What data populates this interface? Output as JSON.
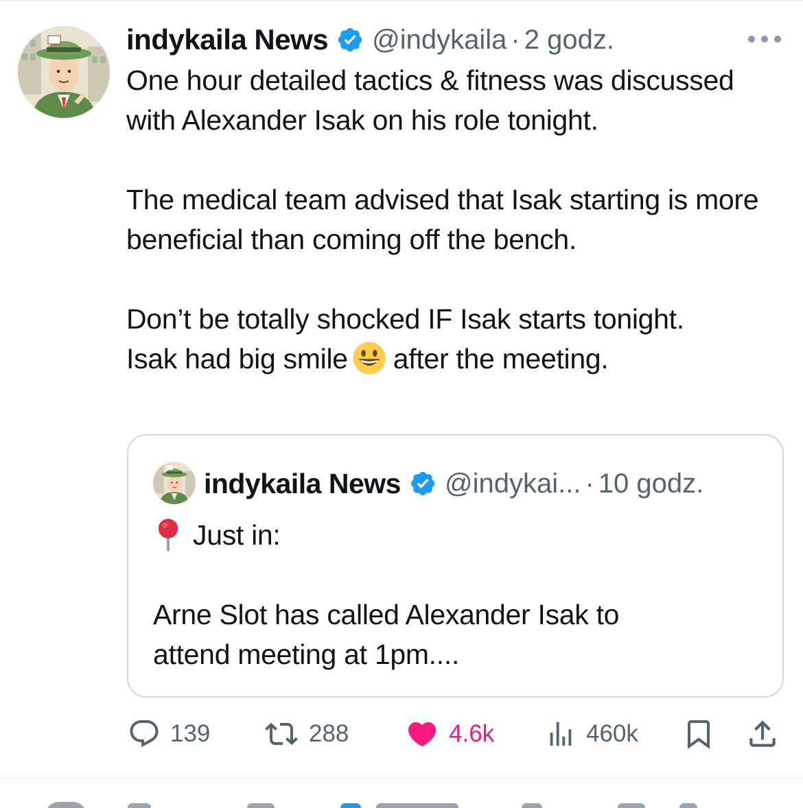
{
  "tweet": {
    "author_name": "indykaila News",
    "handle": "@indykaila",
    "separator": "·",
    "time": "2 godz.",
    "body": [
      "One hour detailed tactics & fitness was discussed with Alexander Isak on his role tonight.",
      "The medical team advised that Isak starting is more beneficial than coming off the bench."
    ],
    "body_last_line1": "Don’t be totally shocked IF Isak starts tonight.",
    "body_last_line2_before": "Isak had big smile",
    "body_last_line2_after": "after the meeting.",
    "emoji_icon": "grinning-face-emoji",
    "verified_icon": "verified-badge-icon",
    "verified_color": "#1d9bf0",
    "more_icon": "more-dots-icon"
  },
  "quote": {
    "author_name": "indykaila News",
    "handle": "@indykai...",
    "separator": "·",
    "time": "10 godz.",
    "pin_icon": "round-pushpin-emoji",
    "line1": "Just in:",
    "line2": "Arne Slot has called Alexander Isak to",
    "line3": "attend meeting at 1pm...."
  },
  "actions": {
    "replies": "139",
    "reposts": "288",
    "likes": "4.6k",
    "views": "460k",
    "like_color": "#f91880",
    "icon_color": "#536471"
  }
}
